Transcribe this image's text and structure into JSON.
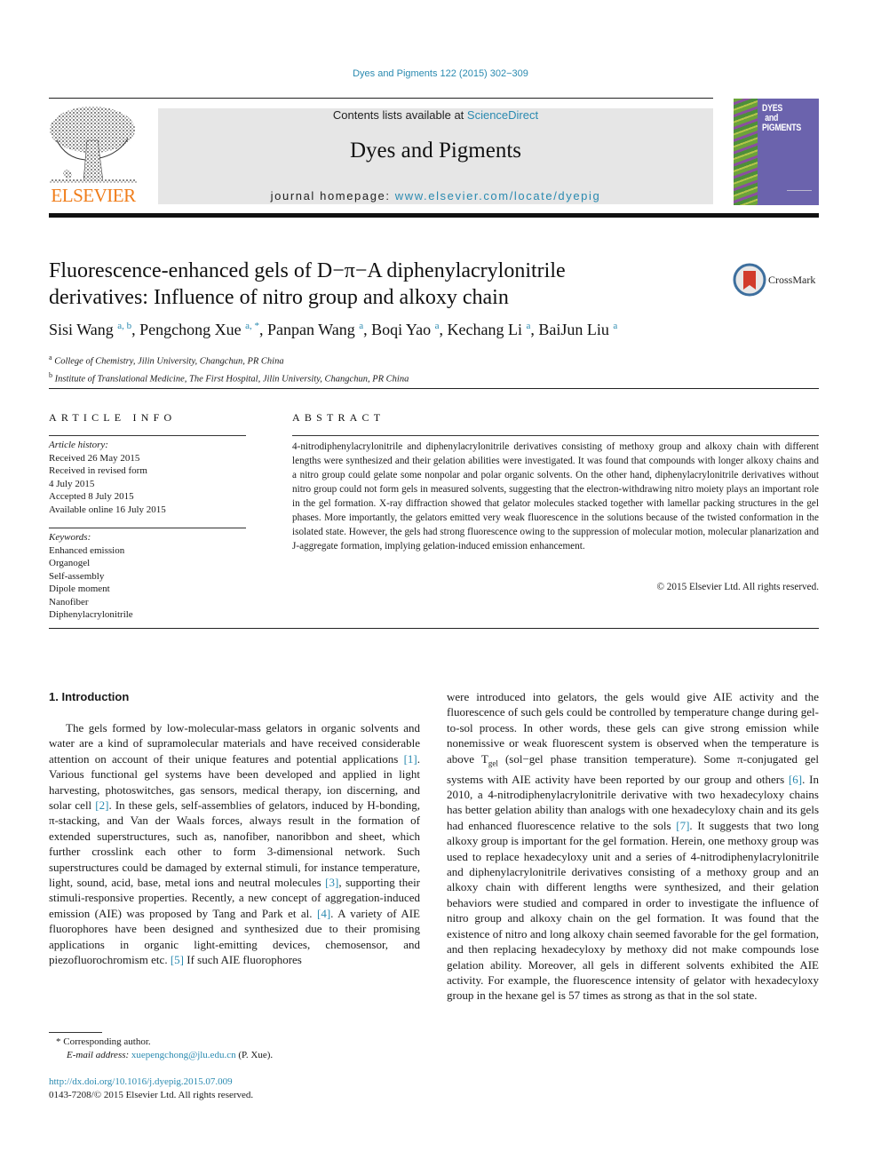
{
  "header": {
    "journal_ref": "Dyes and Pigments 122 (2015) 302−309",
    "publisher_logo_text": "ELSEVIER",
    "contents_prefix": "Contents lists available at ",
    "contents_link": "ScienceDirect",
    "journal_title": "Dyes and Pigments",
    "homepage_prefix": "journal homepage: ",
    "homepage_link": "www.elsevier.com/locate/dyepig",
    "cover_title_lines": [
      "DYES",
      "and",
      "PIGMENTS"
    ],
    "crossmark_label": "CrossMark",
    "colors": {
      "link": "#2a8ab0",
      "elsevier_orange": "#f07d1a",
      "cover_purple": "#6b63ad",
      "masthead_gray": "#e6e6e6"
    }
  },
  "article": {
    "title_line1": "Fluorescence-enhanced gels of D−π−A diphenylacrylonitrile",
    "title_line2": "derivatives: Influence of nitro group and alkoxy chain",
    "authors": [
      {
        "name": "Sisi Wang",
        "sup": "a, b"
      },
      {
        "name": "Pengchong Xue",
        "sup": "a, *"
      },
      {
        "name": "Panpan Wang",
        "sup": "a"
      },
      {
        "name": "Boqi Yao",
        "sup": "a"
      },
      {
        "name": "Kechang Li",
        "sup": "a"
      },
      {
        "name": "BaiJun Liu",
        "sup": "a"
      }
    ],
    "affiliations": [
      {
        "key": "a",
        "text": "College of Chemistry, Jilin University, Changchun, PR China"
      },
      {
        "key": "b",
        "text": "Institute of Translational Medicine, The First Hospital, Jilin University, Changchun, PR China"
      }
    ]
  },
  "article_info": {
    "heading": "ARTICLE INFO",
    "history_label": "Article history:",
    "history": [
      "Received 26 May 2015",
      "Received in revised form",
      "4 July 2015",
      "Accepted 8 July 2015",
      "Available online 16 July 2015"
    ],
    "keywords_label": "Keywords:",
    "keywords": [
      "Enhanced emission",
      "Organogel",
      "Self-assembly",
      "Dipole moment",
      "Nanofiber",
      "Diphenylacrylonitrile"
    ]
  },
  "abstract": {
    "heading": "ABSTRACT",
    "text": "4-nitrodiphenylacrylonitrile and diphenylacrylonitrile derivatives consisting of methoxy group and alkoxy chain with different lengths were synthesized and their gelation abilities were investigated. It was found that compounds with longer alkoxy chains and a nitro group could gelate some nonpolar and polar organic solvents. On the other hand, diphenylacrylonitrile derivatives without nitro group could not form gels in measured solvents, suggesting that the electron-withdrawing nitro moiety plays an important role in the gel formation. X-ray diffraction showed that gelator molecules stacked together with lamellar packing structures in the gel phases. More importantly, the gelators emitted very weak fluorescence in the solutions because of the twisted conformation in the isolated state. However, the gels had strong fluorescence owing to the suppression of molecular motion, molecular planarization and J-aggregate formation, implying gelation-induced emission enhancement.",
    "copyright": "© 2015 Elsevier Ltd. All rights reserved."
  },
  "body": {
    "section_heading": "1.  Introduction",
    "left_parts": [
      {
        "t": "The gels formed by low-molecular-mass gelators in organic solvents and water are a kind of supramolecular materials and have received considerable attention on account of their unique features and potential applications "
      },
      {
        "ref": "[1]"
      },
      {
        "t": ". Various functional gel systems have been developed and applied in light harvesting, photoswitches, gas sensors, medical therapy, ion discerning, and solar cell "
      },
      {
        "ref": "[2]"
      },
      {
        "t": ". In these gels, self-assemblies of gelators, induced by H-bonding, π-stacking, and Van der Waals forces, always result in the formation of extended superstructures, such as, nanofiber, nanoribbon and sheet, which further crosslink each other to form 3-dimensional network. Such superstructures could be damaged by external stimuli, for instance temperature, light, sound, acid, base, metal ions and neutral molecules "
      },
      {
        "ref": "[3]"
      },
      {
        "t": ", supporting their stimuli-responsive properties. Recently, a new concept of aggregation-induced emission (AIE) was proposed by Tang and Park et al. "
      },
      {
        "ref": "[4]"
      },
      {
        "t": ". A variety of AIE fluorophores have been designed and synthesized due to their promising applications in organic light-emitting devices, chemosensor, and piezofluorochromism etc. "
      },
      {
        "ref": "[5]"
      },
      {
        "t": " If such AIE fluorophores"
      }
    ],
    "right_parts": [
      {
        "t": "were introduced into gelators, the gels would give AIE activity and the fluorescence of such gels could be controlled by temperature change during gel-to-sol process. In other words, these gels can give strong emission while nonemissive or weak fluorescent system is observed when the temperature is above T"
      },
      {
        "sub": "gel"
      },
      {
        "t": " (sol−gel phase transition temperature). Some π-conjugated gel systems with AIE activity have been reported by our group and others "
      },
      {
        "ref": "[6]"
      },
      {
        "t": ". In 2010, a 4-nitrodiphenylacrylonitrile derivative with two hexadecyloxy chains has better gelation ability than analogs with one hexadecyloxy chain and its gels had enhanced fluorescence relative to the sols "
      },
      {
        "ref": "[7]"
      },
      {
        "t": ". It suggests that two long alkoxy group is important for the gel formation. Herein, one methoxy group was used to replace hexadecyloxy unit and a series of 4-nitrodiphenylacrylonitrile and diphenylacrylonitrile derivatives consisting of a methoxy group and an alkoxy chain with different lengths were synthesized, and their gelation behaviors were studied and compared in order to investigate the influence of nitro group and alkoxy chain on the gel formation. It was found that the existence of nitro and long alkoxy chain seemed favorable for the gel formation, and then replacing hexadecyloxy by methoxy did not make compounds lose gelation ability. Moreover, all gels in different solvents exhibited the AIE activity. For example, the fluorescence intensity of gelator with hexadecyloxy group in the hexane gel is 57 times as strong as that in the sol state."
      }
    ]
  },
  "footnotes": {
    "corresponding": "* Corresponding author.",
    "email_label": "E-mail address: ",
    "email": "xuepengchong@jlu.edu.cn",
    "email_suffix": " (P. Xue).",
    "doi": "http://dx.doi.org/10.1016/j.dyepig.2015.07.009",
    "issn_copyright": "0143-7208/© 2015 Elsevier Ltd. All rights reserved."
  }
}
